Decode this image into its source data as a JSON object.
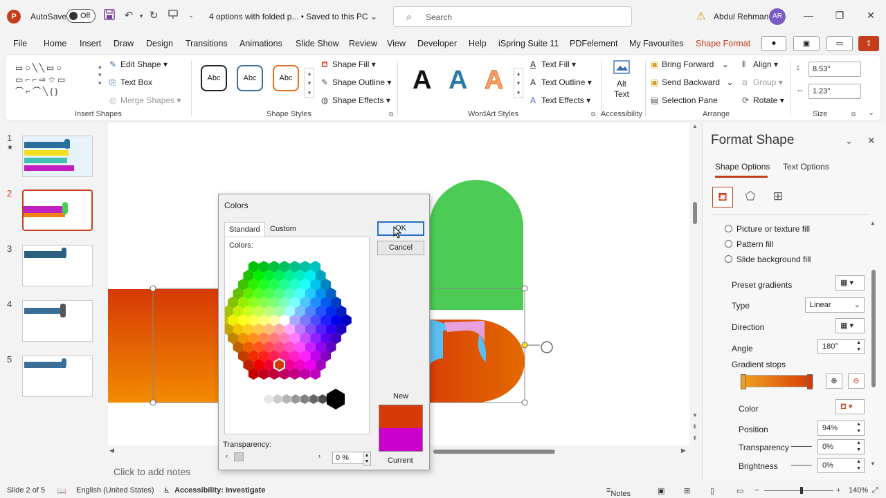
{
  "titlebar": {
    "app_letter": "P",
    "autosave_label": "AutoSave",
    "autosave_state": "Off",
    "doc_title": "4 options with folded p...  •  Saved to this PC",
    "search_placeholder": "Search",
    "user_name": "Abdul Rehman",
    "user_initials": "AR"
  },
  "menu": {
    "tabs": [
      "File",
      "Home",
      "Insert",
      "Draw",
      "Design",
      "Transitions",
      "Animations",
      "Slide Show",
      "Review",
      "View",
      "Developer",
      "Help",
      "iSpring Suite 11",
      "PDFelement",
      "My Favourites",
      "Shape Format"
    ],
    "active_tab": "Shape Format"
  },
  "ribbon": {
    "insert_shapes": {
      "label": "Insert Shapes",
      "edit_shape": "Edit Shape",
      "text_box": "Text Box",
      "merge_shapes": "Merge Shapes"
    },
    "shape_styles": {
      "label": "Shape Styles",
      "preset_text": "Abc",
      "shape_fill": "Shape Fill",
      "shape_outline": "Shape Outline",
      "shape_effects": "Shape Effects"
    },
    "wordart": {
      "label": "WordArt Styles",
      "letter": "A",
      "text_fill": "Text Fill",
      "text_outline": "Text Outline",
      "text_effects": "Text Effects"
    },
    "accessibility": {
      "label": "Accessibility",
      "alt_text_line1": "Alt",
      "alt_text_line2": "Text"
    },
    "arrange": {
      "label": "Arrange",
      "bring_forward": "Bring Forward",
      "send_backward": "Send Backward",
      "selection_pane": "Selection Pane",
      "align": "Align",
      "group": "Group",
      "rotate": "Rotate"
    },
    "size": {
      "label": "Size",
      "height": "8.53\"",
      "width": "1.23\""
    }
  },
  "slides": [
    {
      "num": "1",
      "star": "★"
    },
    {
      "num": "2"
    },
    {
      "num": "3"
    },
    {
      "num": "4"
    },
    {
      "num": "5"
    }
  ],
  "active_slide": 2,
  "notes_placeholder": "Click to add notes",
  "colors_dialog": {
    "title": "Colors",
    "tab_standard": "Standard",
    "tab_custom": "Custom",
    "colors_label": "Colors:",
    "ok": "OK",
    "cancel": "Cancel",
    "new_label": "New",
    "current_label": "Current",
    "new_color": "#d63a06",
    "current_color": "#cc00cc",
    "transparency_label": "Transparency:",
    "transparency_value": "0 %"
  },
  "format_pane": {
    "title": "Format Shape",
    "tab_shape": "Shape Options",
    "tab_text": "Text Options",
    "fill_options": [
      "Picture or texture fill",
      "Pattern fill",
      "Slide background fill"
    ],
    "preset_gradients": "Preset gradients",
    "type_label": "Type",
    "type_value": "Linear",
    "direction_label": "Direction",
    "angle_label": "Angle",
    "angle_value": "180°",
    "gradient_stops_label": "Gradient stops",
    "color_label": "Color",
    "position_label": "Position",
    "position_value": "94%",
    "transparency_label": "Transparency",
    "transparency_value": "0%",
    "brightness_label": "Brightness",
    "brightness_value": "0%"
  },
  "status": {
    "slide_info": "Slide 2 of 5",
    "language": "English (United States)",
    "accessibility": "Accessibility: Investigate",
    "notes": "Notes",
    "zoom": "140%"
  },
  "colors": {
    "accent": "#c43e1c",
    "green": "#4ccc55",
    "orange_top": "#d63a06",
    "orange_bottom": "#f28a00",
    "light_blue": "#5bbcf0",
    "pink": "#e8a0dc"
  }
}
